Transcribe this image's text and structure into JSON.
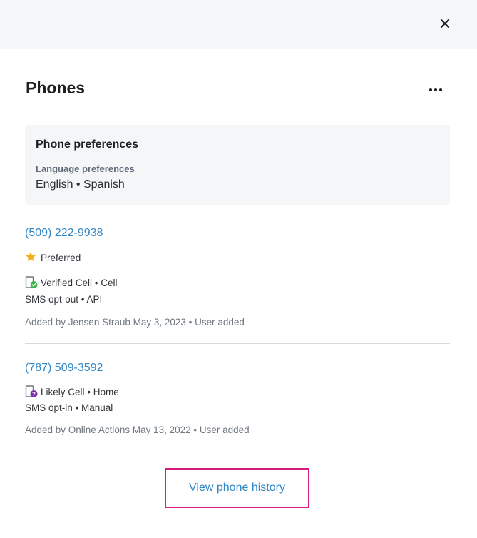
{
  "panel": {
    "title": "Phones",
    "close_icon": "close-icon",
    "more_icon": "more-options-icon"
  },
  "preferences": {
    "title": "Phone preferences",
    "language_label": "Language preferences",
    "language_value": "English • Spanish"
  },
  "phones": [
    {
      "number": "(509) 222-9938",
      "preferred_label": "Preferred",
      "type_icon": "verified-cell-icon",
      "type_text": "Verified Cell • Cell",
      "sms_text": "SMS opt-out • API",
      "added_text": "Added by Jensen Straub May 3, 2023 • User added"
    },
    {
      "number": "(787) 509-3592",
      "type_icon": "likely-cell-icon",
      "type_text": "Likely Cell • Home",
      "sms_text": "SMS opt-in • Manual",
      "added_text": "Added by Online Actions May 13, 2022 • User added"
    }
  ],
  "footer": {
    "history_link": "View phone history"
  },
  "colors": {
    "link": "#2f86c5",
    "highlight_border": "#d81b83",
    "star": "#f2b21b",
    "verified": "#3bb54a",
    "likely": "#7b2fa8"
  }
}
